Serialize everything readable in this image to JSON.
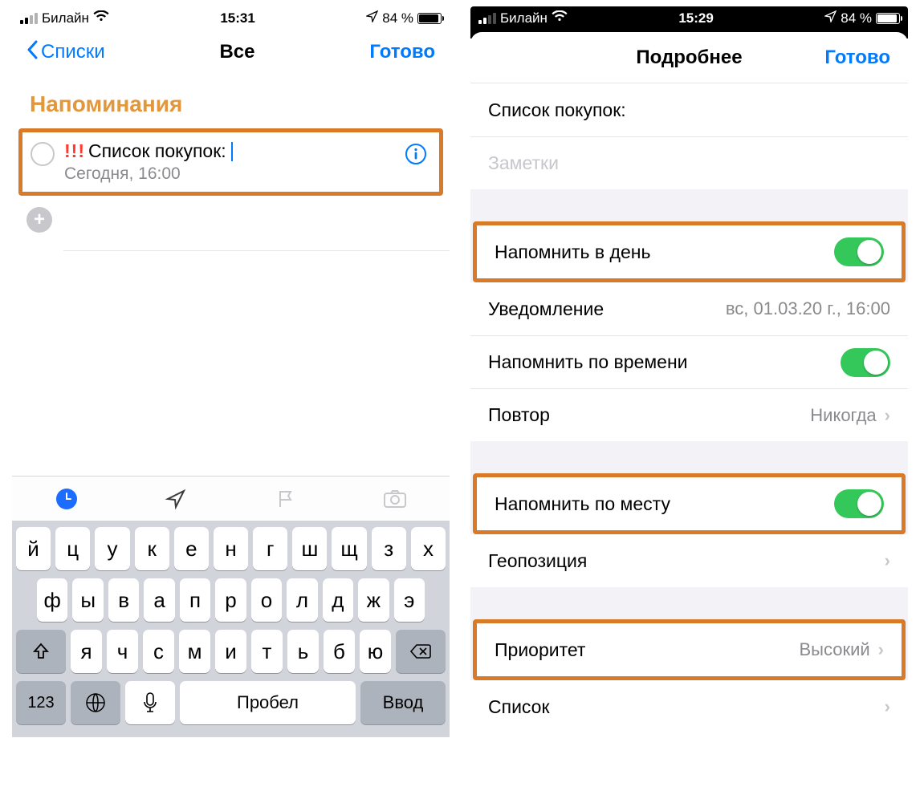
{
  "colors": {
    "accent": "#007aff",
    "highlight": "#d97a29",
    "section_title": "#e3973c",
    "switch_on": "#34c759",
    "priority": "#ff3b30"
  },
  "statusbar_left": {
    "carrier": "Билайн",
    "time": "15:31",
    "battery_pct": "84 %"
  },
  "statusbar_right": {
    "carrier": "Билайн",
    "time": "15:29",
    "battery_pct": "84 %"
  },
  "left_nav": {
    "back": "Списки",
    "title": "Все",
    "done": "Готово"
  },
  "left": {
    "section_title": "Напоминания",
    "reminder": {
      "priority_mark": "!!!",
      "title": "Список покупок:",
      "subtitle": "Сегодня, 16:00"
    }
  },
  "keyboard": {
    "row1": [
      "й",
      "ц",
      "у",
      "к",
      "е",
      "н",
      "г",
      "ш",
      "щ",
      "з",
      "х"
    ],
    "row2": [
      "ф",
      "ы",
      "в",
      "а",
      "п",
      "р",
      "о",
      "л",
      "д",
      "ж",
      "э"
    ],
    "row3": [
      "я",
      "ч",
      "с",
      "м",
      "и",
      "т",
      "ь",
      "б",
      "ю"
    ],
    "shift": "⇧",
    "backspace": "⌫",
    "num": "123",
    "space": "Пробел",
    "enter": "Ввод"
  },
  "right_nav": {
    "title": "Подробнее",
    "done": "Готово"
  },
  "right": {
    "title_field": "Список покупок:",
    "notes_placeholder": "Заметки",
    "cells": {
      "remind_day": "Напомнить в день",
      "alert_label": "Уведомление",
      "alert_value": "вс, 01.03.20 г., 16:00",
      "remind_time": "Напомнить по времени",
      "repeat_label": "Повтор",
      "repeat_value": "Никогда",
      "remind_location": "Напомнить по месту",
      "geolocation": "Геопозиция",
      "priority_label": "Приоритет",
      "priority_value": "Высокий",
      "list_label": "Список"
    }
  }
}
